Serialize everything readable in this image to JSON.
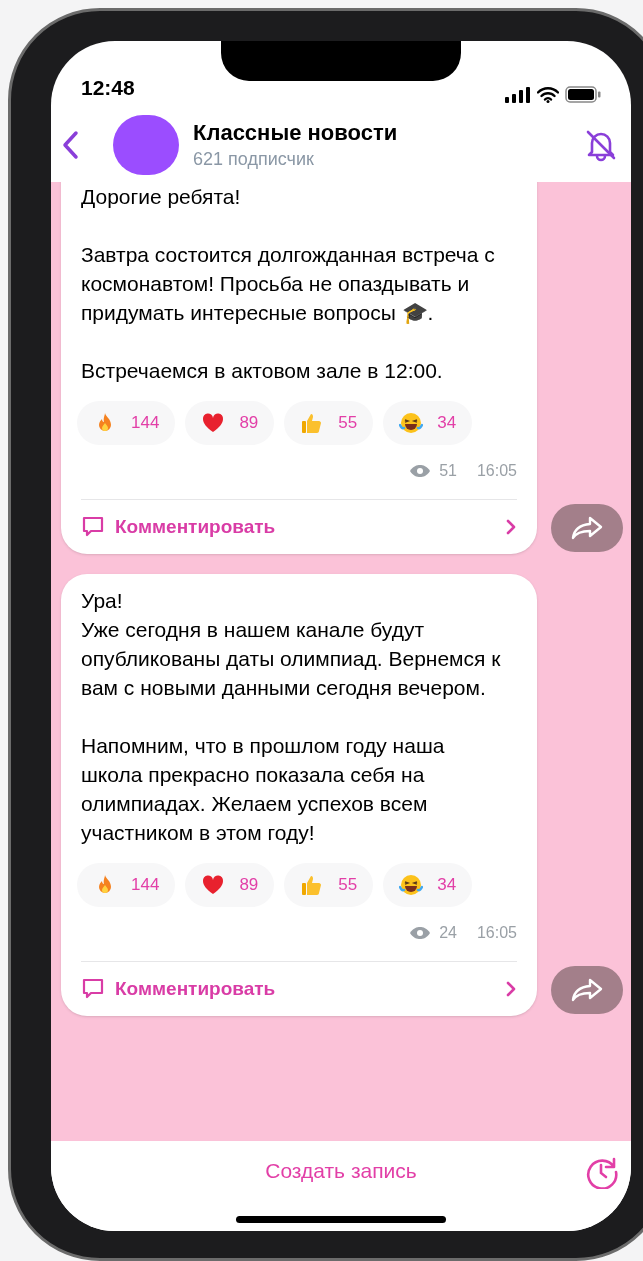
{
  "status_bar": {
    "time": "12:48"
  },
  "channel": {
    "title": "Классные новости",
    "subtitle": "621 подписчик",
    "muted": true
  },
  "posts": [
    {
      "text": "Дорогие ребята!\n\nЗавтра состоится долгожданная встреча с космонавтом! Просьба не опаздывать и придумать интересные вопросы 🎓.\n\nВстречаемся в актовом зале в 12:00.",
      "reactions": [
        {
          "kind": "fire",
          "count": "144"
        },
        {
          "kind": "heart",
          "count": "89"
        },
        {
          "kind": "thumbs_up",
          "count": "55"
        },
        {
          "kind": "laugh",
          "count": "34"
        }
      ],
      "views": "51",
      "time": "16:05",
      "comment_label": "Комментировать",
      "top_cut": true
    },
    {
      "text": "Ура!\nУже сегодня в нашем канале будут опубликованы даты олимпиад. Вернемся к вам с новыми данными сегодня вечером.\n\nНапомним, что в прошлом году наша школа прекрасно показала себя на олимпиадах. Желаем успехов всем участником в этом году!",
      "reactions": [
        {
          "kind": "fire",
          "count": "144"
        },
        {
          "kind": "heart",
          "count": "89"
        },
        {
          "kind": "thumbs_up",
          "count": "55"
        },
        {
          "kind": "laugh",
          "count": "34"
        }
      ],
      "views": "24",
      "time": "16:05",
      "comment_label": "Комментировать",
      "top_cut": false
    }
  ],
  "bottom_bar": {
    "action": "Создать запись"
  }
}
